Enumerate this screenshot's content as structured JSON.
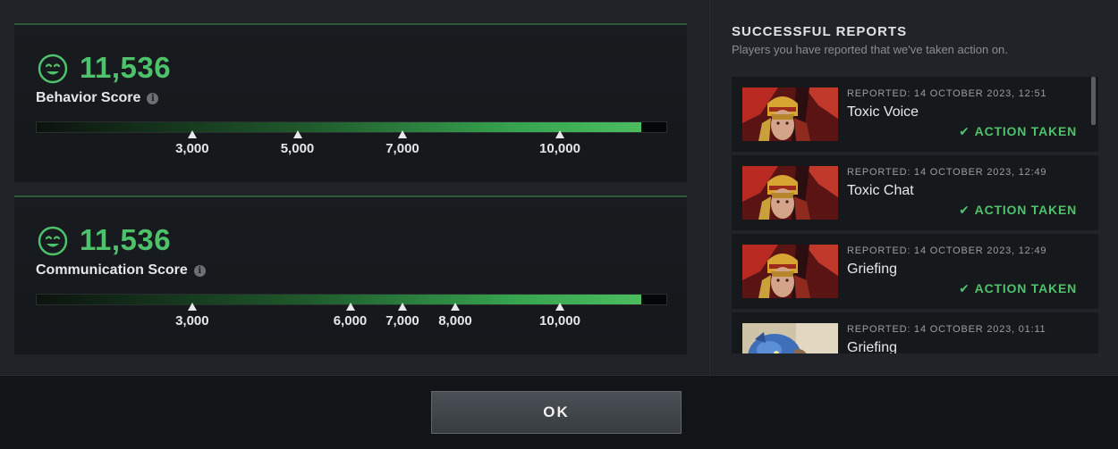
{
  "behavior": {
    "value": "11,536",
    "label": "Behavior Score",
    "fill_fraction": 0.96,
    "markers": [
      {
        "label": "3,000",
        "position": 0.2484
      },
      {
        "label": "5,000",
        "position": 0.4155
      },
      {
        "label": "7,000",
        "position": 0.5824
      },
      {
        "label": "10,000",
        "position": 0.8324
      }
    ]
  },
  "communication": {
    "value": "11,536",
    "label": "Communication Score",
    "fill_fraction": 0.96,
    "markers": [
      {
        "label": "3,000",
        "position": 0.2484
      },
      {
        "label": "6,000",
        "position": 0.4993
      },
      {
        "label": "7,000",
        "position": 0.5824
      },
      {
        "label": "8,000",
        "position": 0.6662
      },
      {
        "label": "10,000",
        "position": 0.8324
      }
    ]
  },
  "reports": {
    "title": "SUCCESSFUL REPORTS",
    "subtitle": "Players you have reported that we've taken action on.",
    "items": [
      {
        "date": "REPORTED: 14 OCTOBER 2023, 12:51",
        "reason": "Toxic Voice",
        "status": "ACTION TAKEN",
        "hero": "hero-portrait-gold-helmet"
      },
      {
        "date": "REPORTED: 14 OCTOBER 2023, 12:49",
        "reason": "Toxic Chat",
        "status": "ACTION TAKEN",
        "hero": "hero-portrait-gold-helmet"
      },
      {
        "date": "REPORTED: 14 OCTOBER 2023, 12:49",
        "reason": "Griefing",
        "status": "ACTION TAKEN",
        "hero": "hero-portrait-gold-helmet"
      },
      {
        "date": "REPORTED: 14 OCTOBER 2023, 01:11",
        "reason": "Griefing",
        "status": "",
        "hero": "hero-portrait-blue-creature"
      }
    ]
  },
  "footer": {
    "ok_label": "OK"
  },
  "colors": {
    "accent_green": "#4ec26a",
    "background": "#1d2024"
  }
}
